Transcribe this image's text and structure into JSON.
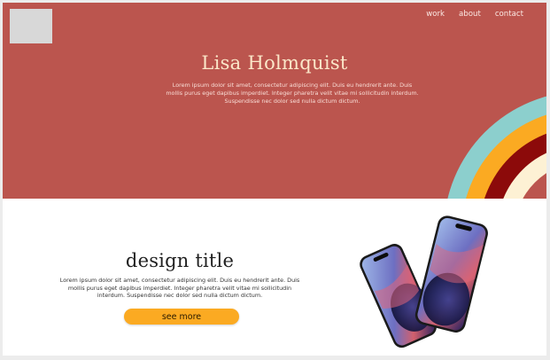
{
  "nav": {
    "items": [
      "work",
      "about",
      "contact"
    ]
  },
  "hero": {
    "title": "Lisa Holmquist",
    "text": "Lorem ipsum dolor sit amet, consectetur adipiscing elit. Duis eu hendrerit ante. Duis mollis purus eget dapibus imperdiet. Integer pharetra velit vitae mi sollicitudin interdum. Suspendisse nec dolor sed nulla dictum dictum."
  },
  "design": {
    "title": "design title",
    "text": "Lorem ipsum dolor sit amet, consectetur adipiscing elit. Duis eu hendrerit ante. Duis mollis purus eget dapibus imperdiet. Integer pharetra velit vitae mi sollicitudin interdum. Suspendisse nec dolor sed nulla dictum dictum.",
    "button_label": "see more"
  },
  "colors": {
    "hero_bg": "#bb554e",
    "arc_teal": "#8ccfcd",
    "arc_yellow": "#fbaa22",
    "arc_darkred": "#8c0a0a",
    "arc_cream": "#fdf1d4",
    "button": "#fbaa22"
  },
  "icons": {
    "logo": "logo-placeholder",
    "phones": "smartphone-illustration"
  }
}
